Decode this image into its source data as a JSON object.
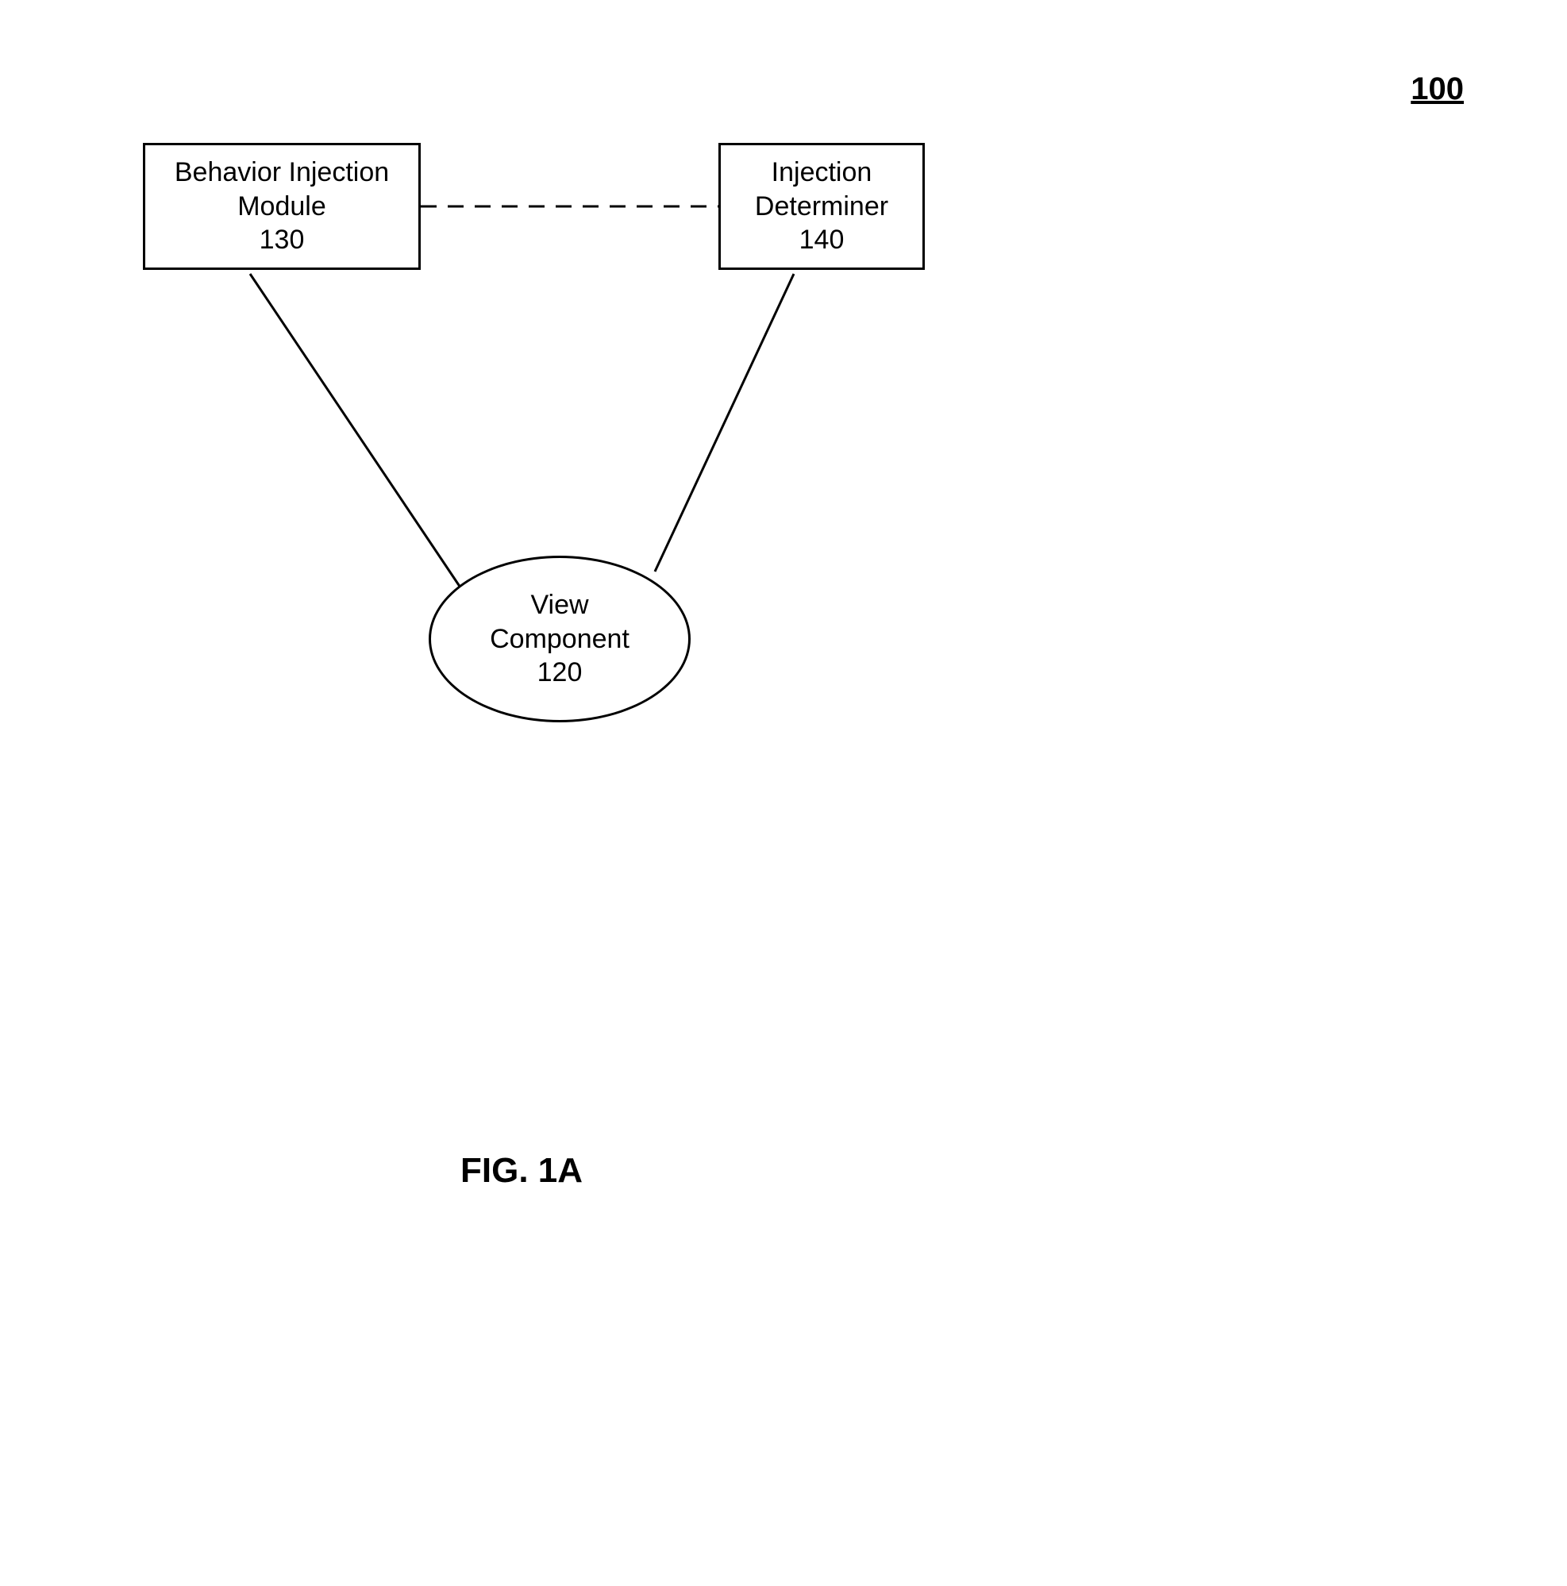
{
  "page": {
    "number_label": "100"
  },
  "boxes": {
    "behavior_injection": {
      "line1": "Behavior Injection",
      "line2": "Module",
      "line3": "130"
    },
    "injection_determiner": {
      "line1": "Injection",
      "line2": "Determiner",
      "line3": "140"
    }
  },
  "ellipse": {
    "view_component": {
      "line1": "View",
      "line2": "Component",
      "line3": "120"
    }
  },
  "caption": "FIG. 1A"
}
